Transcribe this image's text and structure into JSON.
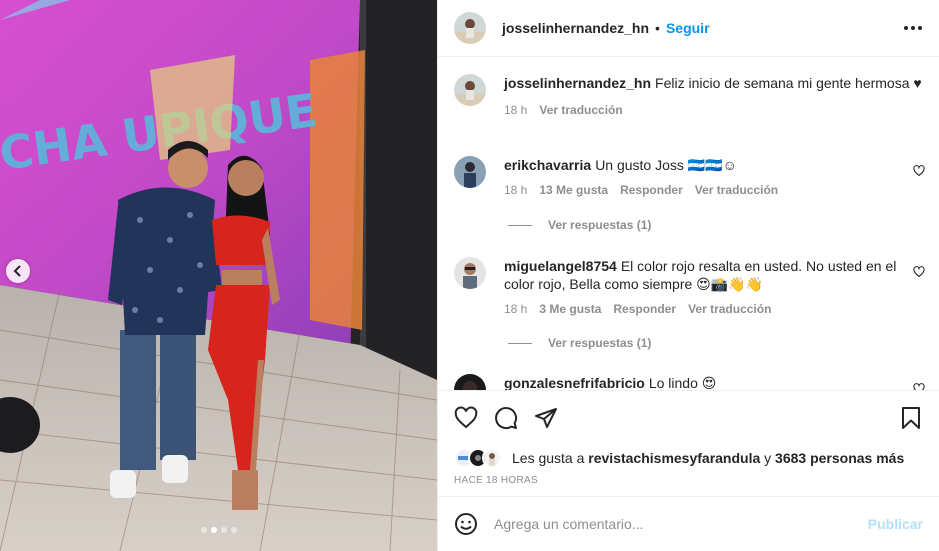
{
  "post": {
    "username": "josselinhernandez_hn",
    "separator": "•",
    "follow_label": "Seguir",
    "caption": "Feliz inicio de semana mi gente hermosa ♥",
    "caption_time": "18 h",
    "caption_translate": "Ver traducción"
  },
  "photo": {
    "screen_text": "CHA UPIQUE",
    "slide_index": 1,
    "slide_count": 4
  },
  "comments": [
    {
      "username": "erikchavarria",
      "text": "Un gusto Joss 🇭🇳🇭🇳☺",
      "time": "18 h",
      "likes": "13 Me gusta",
      "reply": "Responder",
      "translate": "Ver traducción",
      "view_replies": "Ver respuestas (1)"
    },
    {
      "username": "miguelangel8754",
      "text": "El color rojo resalta en usted. No usted en el color rojo, Bella como siempre 😍📸👋👋",
      "time": "18 h",
      "likes": "3 Me gusta",
      "reply": "Responder",
      "translate": "Ver traducción",
      "view_replies": "Ver respuestas (1)"
    },
    {
      "username": "gonzalesnefrifabricio",
      "text": "Lo lindo 😍"
    }
  ],
  "likes": {
    "prefix": "Les gusta a ",
    "user": "revistachismesyfarandula",
    "middle": " y ",
    "count": "3683 personas más"
  },
  "time_ago": "HACE 18 HORAS",
  "composer": {
    "placeholder": "Agrega un comentario...",
    "publish_label": "Publicar"
  },
  "icons": {
    "more": "more-options-icon",
    "like": "heart-icon",
    "comment": "comment-icon",
    "share": "share-icon",
    "save": "bookmark-icon",
    "emoji": "emoji-icon",
    "prev": "chevron-left-icon"
  },
  "colors": {
    "link_blue": "#0095f6",
    "publish_disabled": "#b2dffc",
    "muted": "#8e8e8e",
    "text": "#262626"
  }
}
